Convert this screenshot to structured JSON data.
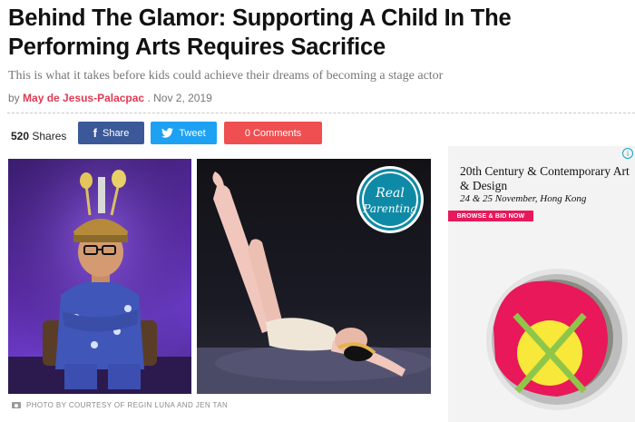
{
  "article": {
    "title": "Behind The Glamor: Supporting A Child In The Performing Arts Requires Sacrifice",
    "subtitle": "This is what it takes before kids could achieve their dreams of becoming a stage actor",
    "byline_prefix": "by",
    "author": "May de Jesus-Palacpac",
    "date": ". Nov 2, 2019"
  },
  "share_bar": {
    "count": "520",
    "count_label": "Shares",
    "facebook_label": "Share",
    "twitter_label": "Tweet",
    "comments_label": "0 Comments",
    "colors": {
      "facebook": "#3b5998",
      "twitter": "#1da1f2",
      "comments": "#ef4f50"
    }
  },
  "photo": {
    "caption": "PHOTO BY COURTESY OF REGIN LUNA AND JEN TAN",
    "logo_text_line1": "Real",
    "logo_text_line2": "Parenting"
  },
  "ad": {
    "title": "20th Century & Contemporary Art & Design",
    "date": "24 & 25 November, Hong Kong",
    "cta": "BROWSE & BID NOW",
    "choice_icon": "i"
  },
  "colors": {
    "author": "#e03a52",
    "ad_cta": "#e8185a",
    "logo_teal": "#0f8aa6"
  }
}
